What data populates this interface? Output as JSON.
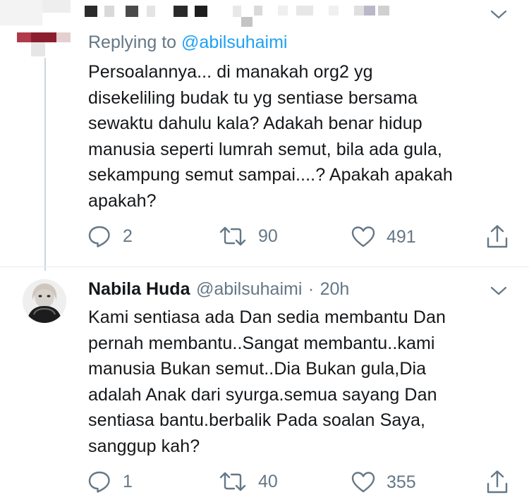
{
  "reply1": {
    "replying_prefix": "Replying to",
    "replying_handle": "@abilsuhaimi",
    "lines": [
      "Persoalannya... di manakah org2 yg",
      "disekeliling budak tu yg sentiase bersama",
      "sewaktu dahulu kala? Adakah benar hidup",
      "manusia seperti lumrah semut, bila ada gula,",
      "sekampung semut sampai....? Apakah apakah",
      "apakah?"
    ],
    "actions": {
      "reply_count": "2",
      "retweet_count": "90",
      "like_count": "491"
    }
  },
  "reply2": {
    "name": "Nabila Huda",
    "handle": "@abilsuhaimi",
    "separator": "·",
    "time": "20h",
    "lines": [
      "Kami sentiasa ada Dan sedia membantu Dan",
      "pernah membantu..Sangat membantu..kami",
      "manusia Bukan semut..Dia Bukan gula,Dia",
      "adalah Anak dari syurga.semua sayang Dan",
      "sentiasa bantu.berbalik Pada soalan Saya,",
      "sanggup kah?"
    ],
    "actions": {
      "reply_count": "1",
      "retweet_count": "40",
      "like_count": "355"
    }
  },
  "icons": {
    "reply": "reply-icon",
    "retweet": "retweet-icon",
    "like": "heart-icon",
    "share": "share-icon",
    "menu": "chevron-down-icon"
  },
  "colors": {
    "link": "#1da1f2",
    "muted": "#657786",
    "text": "#14171a"
  }
}
